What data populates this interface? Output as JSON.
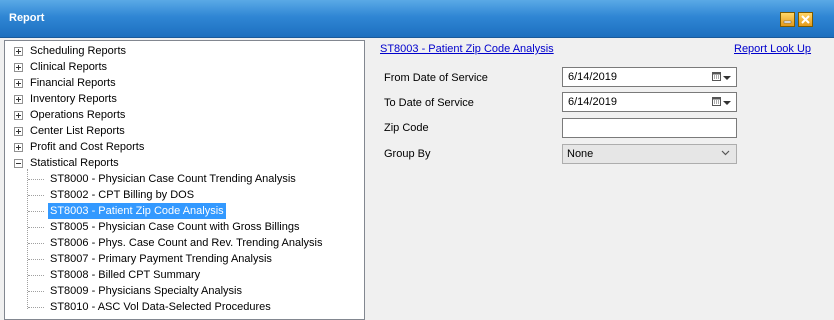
{
  "window": {
    "title": "Report"
  },
  "tree": {
    "categories": [
      {
        "label": "Scheduling Reports",
        "expanded": false
      },
      {
        "label": "Clinical Reports",
        "expanded": false
      },
      {
        "label": "Financial Reports",
        "expanded": false
      },
      {
        "label": "Inventory Reports",
        "expanded": false
      },
      {
        "label": "Operations Reports",
        "expanded": false
      },
      {
        "label": "Center List Reports",
        "expanded": false
      },
      {
        "label": "Profit and Cost Reports",
        "expanded": false
      },
      {
        "label": "Statistical Reports",
        "expanded": true
      }
    ],
    "statistical_children": [
      {
        "label": "ST8000 - Physician Case Count Trending Analysis",
        "selected": false
      },
      {
        "label": "ST8002 - CPT Billing by DOS",
        "selected": false
      },
      {
        "label": "ST8003 - Patient Zip Code Analysis",
        "selected": true
      },
      {
        "label": "ST8005 - Physician Case Count with Gross Billings",
        "selected": false
      },
      {
        "label": "ST8006 - Phys. Case Count and Rev. Trending Analysis",
        "selected": false
      },
      {
        "label": "ST8007 - Primary Payment Trending Analysis",
        "selected": false
      },
      {
        "label": "ST8008 - Billed CPT Summary",
        "selected": false
      },
      {
        "label": "ST8009 - Physicians Specialty Analysis",
        "selected": false
      },
      {
        "label": "ST8010 - ASC Vol Data-Selected Procedures",
        "selected": false
      }
    ]
  },
  "detail": {
    "report_link": "ST8003 - Patient Zip Code Analysis",
    "lookup_link": "Report Look Up",
    "from_label": "From Date of Service",
    "from_value": "6/14/2019",
    "to_label": "To Date of Service",
    "to_value": "6/14/2019",
    "zip_label": "Zip Code",
    "zip_value": "",
    "group_label": "Group By",
    "group_value": "None"
  },
  "colors": {
    "titlebar": "#2f86d4",
    "selection": "#3399ff",
    "link": "#0000cc"
  }
}
